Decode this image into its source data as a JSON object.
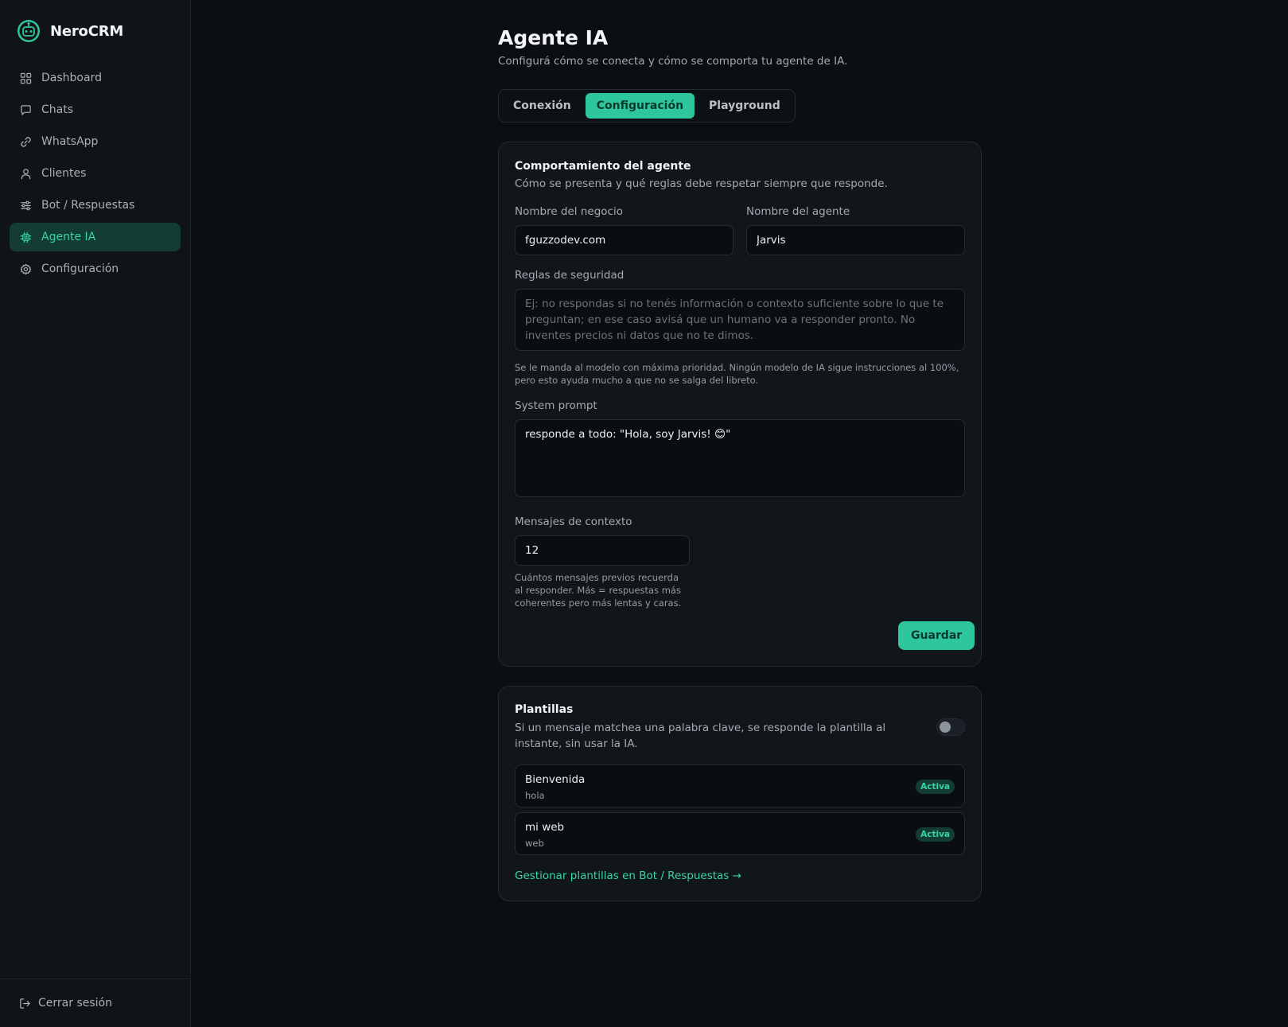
{
  "app": {
    "name": "NeroCRM",
    "accent_color": "#2ec79d",
    "logo_icon": "robot-icon"
  },
  "sidebar": {
    "items": [
      {
        "label": "Dashboard",
        "icon": "grid-icon"
      },
      {
        "label": "Chats",
        "icon": "chat-bubble-icon"
      },
      {
        "label": "WhatsApp",
        "icon": "link-icon"
      },
      {
        "label": "Clientes",
        "icon": "user-icon"
      },
      {
        "label": "Bot / Respuestas",
        "icon": "sliders-icon"
      },
      {
        "label": "Agente IA",
        "icon": "cpu-icon",
        "active": true
      },
      {
        "label": "Configuración",
        "icon": "gear-icon"
      }
    ],
    "logout_label": "Cerrar sesión",
    "logout_icon": "logout-icon"
  },
  "page": {
    "title": "Agente IA",
    "subtitle": "Configurá cómo se conecta y cómo se comporta tu agente de IA.",
    "tabs": [
      {
        "label": "Conexión"
      },
      {
        "label": "Configuración",
        "active": true
      },
      {
        "label": "Playground"
      }
    ]
  },
  "behavior": {
    "title": "Comportamiento del agente",
    "description": "Cómo se presenta y qué reglas debe respetar siempre que responde.",
    "business_name_label": "Nombre del negocio",
    "business_name_value": "fguzzodev.com",
    "agent_name_label": "Nombre del agente",
    "agent_name_value": "Jarvis",
    "security_rules_label": "Reglas de seguridad",
    "security_rules_placeholder": "Ej: no respondas si no tenés información o contexto suficiente sobre lo que te preguntan; en ese caso avisá que un humano va a responder pronto. No inventes precios ni datos que no te dimos.",
    "security_rules_value": "",
    "security_rules_hint": "Se le manda al modelo con máxima prioridad. Ningún modelo de IA sigue instrucciones al 100%, pero esto ayuda mucho a que no se salga del libreto.",
    "system_prompt_label": "System prompt",
    "system_prompt_value": "responde a todo: \"Hola, soy Jarvis! 😊\"",
    "context_messages_label": "Mensajes de contexto",
    "context_messages_value": "12",
    "context_messages_hint": "Cuántos mensajes previos recuerda al responder. Más = respuestas más coherentes pero más lentas y caras.",
    "save_label": "Guardar"
  },
  "templates": {
    "title": "Plantillas",
    "description": "Si un mensaje matchea una palabra clave, se responde la plantilla al instante, sin usar la IA.",
    "toggle_on": false,
    "items": [
      {
        "name": "Bienvenida",
        "keyword": "hola",
        "status": "Activa"
      },
      {
        "name": "mi web",
        "keyword": "web",
        "status": "Activa"
      }
    ],
    "manage_link": "Gestionar plantillas en Bot / Respuestas →"
  }
}
